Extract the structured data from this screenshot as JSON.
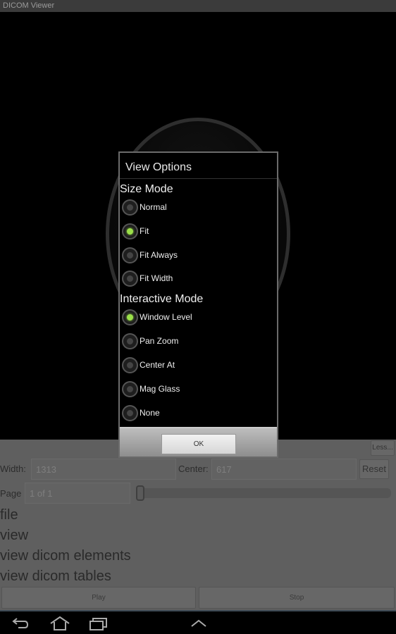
{
  "app": {
    "title": "DICOM Viewer"
  },
  "panel": {
    "less_label": "Less...",
    "width_label": "Width:",
    "width_value": "1313",
    "center_label": "Center:",
    "center_value": "617",
    "reset_label": "Reset",
    "page_label": "Page",
    "page_value": "1 of 1",
    "page_slider_fraction": 0,
    "menu": [
      "file",
      "view",
      "view dicom elements",
      "view dicom tables"
    ],
    "play_label": "Play",
    "stop_label": "Stop"
  },
  "dialog": {
    "title": "View Options",
    "size_mode": {
      "label": "Size Mode",
      "options": [
        {
          "label": "Normal",
          "selected": false
        },
        {
          "label": "Fit",
          "selected": true
        },
        {
          "label": "Fit Always",
          "selected": false
        },
        {
          "label": "Fit Width",
          "selected": false
        }
      ]
    },
    "interactive_mode": {
      "label": "Interactive Mode",
      "options": [
        {
          "label": "Window Level",
          "selected": true
        },
        {
          "label": "Pan Zoom",
          "selected": false
        },
        {
          "label": "Center At",
          "selected": false
        },
        {
          "label": "Mag Glass",
          "selected": false
        },
        {
          "label": "None",
          "selected": false
        }
      ]
    },
    "ok_label": "OK",
    "accent": "#9be04a"
  },
  "navbar": {
    "icons": [
      "back-icon",
      "home-icon",
      "recent-apps-icon",
      "chevron-up-icon"
    ]
  }
}
